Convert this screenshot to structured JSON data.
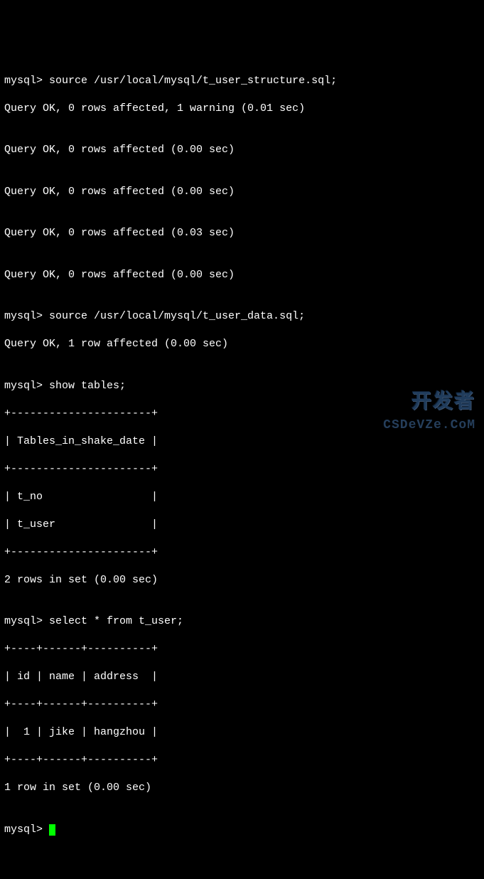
{
  "terminal": {
    "prompt": "mysql>",
    "lines": [
      "mysql> source /usr/local/mysql/t_user_structure.sql;",
      "Query OK, 0 rows affected, 1 warning (0.01 sec)",
      "",
      "Query OK, 0 rows affected (0.00 sec)",
      "",
      "Query OK, 0 rows affected (0.00 sec)",
      "",
      "Query OK, 0 rows affected (0.03 sec)",
      "",
      "Query OK, 0 rows affected (0.00 sec)",
      "",
      "mysql> source /usr/local/mysql/t_user_data.sql;",
      "Query OK, 1 row affected (0.00 sec)",
      "",
      "mysql> show tables;",
      "+----------------------+",
      "| Tables_in_shake_date |",
      "+----------------------+",
      "| t_no                 |",
      "| t_user               |",
      "+----------------------+",
      "2 rows in set (0.00 sec)",
      "",
      "mysql> select * from t_user;",
      "+----+------+----------+",
      "| id | name | address  |",
      "+----+------+----------+",
      "|  1 | jike | hangzhou |",
      "+----+------+----------+",
      "1 row in set (0.00 sec)",
      ""
    ],
    "final_prompt": "mysql> "
  },
  "commands": {
    "cmd1": "source /usr/local/mysql/t_user_structure.sql;",
    "cmd2": "source /usr/local/mysql/t_user_data.sql;",
    "cmd3": "show tables;",
    "cmd4": "select * from t_user;"
  },
  "tables_result": {
    "header": "Tables_in_shake_date",
    "rows": [
      "t_no",
      "t_user"
    ],
    "summary": "2 rows in set (0.00 sec)"
  },
  "select_result": {
    "columns": [
      "id",
      "name",
      "address"
    ],
    "rows": [
      {
        "id": "1",
        "name": "jike",
        "address": "hangzhou"
      }
    ],
    "summary": "1 row in set (0.00 sec)"
  },
  "watermarks": {
    "brand_cn": "开发者",
    "brand_en": "CSDeVZe.CoM"
  }
}
